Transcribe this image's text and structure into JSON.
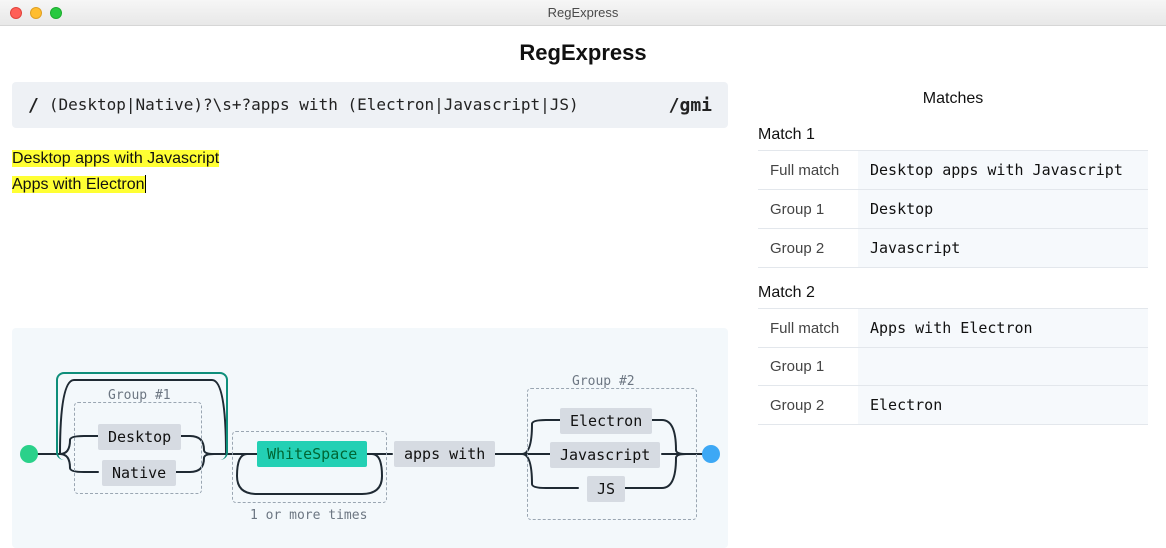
{
  "window": {
    "title": "RegExpress"
  },
  "app": {
    "title": "RegExpress"
  },
  "regex": {
    "open": "/",
    "body": "(Desktop|Native)?\\s+?apps with (Electron|Javascript|JS)",
    "flags": "/gmi"
  },
  "test_lines": {
    "line1": "Desktop apps with Javascript",
    "line2": "Apps with Electron"
  },
  "matches_panel": {
    "title": "Matches",
    "labels": {
      "full_match": "Full match",
      "group1": "Group 1",
      "group2": "Group 2"
    },
    "matches": [
      {
        "heading": "Match 1",
        "full": "Desktop apps with Javascript",
        "group1": "Desktop",
        "group2": "Javascript"
      },
      {
        "heading": "Match 2",
        "full": "Apps with Electron",
        "group1": "",
        "group2": "Electron"
      }
    ]
  },
  "diagram": {
    "group1_label": "Group #1",
    "group2_label": "Group #2",
    "repeat_note": "1 or more times",
    "whitespace": "WhiteSpace",
    "literal": "apps with",
    "group1_options": [
      "Desktop",
      "Native"
    ],
    "group2_options": [
      "Electron",
      "Javascript",
      "JS"
    ]
  }
}
